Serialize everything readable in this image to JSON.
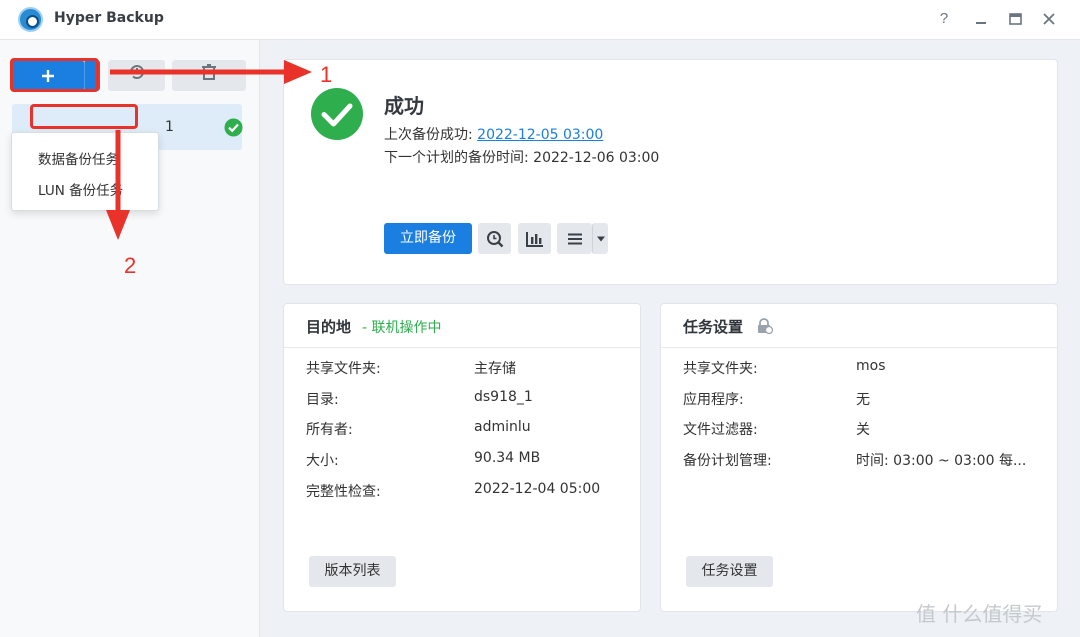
{
  "window": {
    "title": "Hyper Backup",
    "help_label": "?"
  },
  "sidebar": {
    "task_label": "1",
    "create_menu": {
      "items": [
        {
          "label": "数据备份任务"
        },
        {
          "label": "LUN 备份任务"
        }
      ]
    }
  },
  "status": {
    "title": "成功",
    "last_backup_label": "上次备份成功: ",
    "last_backup_value": "2022-12-05 03:00",
    "next_backup_text": "下一个计划的备份时间: 2022-12-06 03:00",
    "backup_now_label": "立即备份"
  },
  "destination": {
    "title": "目的地",
    "status": "- 联机操作中",
    "rows": [
      {
        "label": "共享文件夹:",
        "value": "主存储"
      },
      {
        "label": "目录:",
        "value": "ds918_1"
      },
      {
        "label": "所有者:",
        "value": "adminlu"
      },
      {
        "label": "大小:",
        "value": "90.34 MB"
      },
      {
        "label": "完整性检查:",
        "value": "2022-12-04 05:00"
      }
    ],
    "button_label": "版本列表"
  },
  "task_settings": {
    "title": "任务设置",
    "rows": [
      {
        "label": "共享文件夹:",
        "value": "mos"
      },
      {
        "label": "应用程序:",
        "value": "无"
      },
      {
        "label": "文件过滤器:",
        "value": "关"
      },
      {
        "label": "备份计划管理:",
        "value": "时间: 03:00 ~ 03:00 每..."
      }
    ],
    "button_label": "任务设置"
  },
  "annotations": {
    "step1": "1",
    "step2": "2",
    "color": "#e8322a"
  },
  "watermark": {
    "text": "值 什么值得买"
  },
  "colors": {
    "accent": "#1a7fe0",
    "success": "#2eae4d"
  },
  "icons": [
    "app-icon",
    "help-icon",
    "minimize-icon",
    "maximize-icon",
    "close-icon",
    "plus-icon",
    "restore-icon",
    "delete-icon",
    "check-circle-icon",
    "log-search-icon",
    "bar-chart-icon",
    "menu-icon",
    "chevron-down-icon",
    "lock-icon"
  ]
}
